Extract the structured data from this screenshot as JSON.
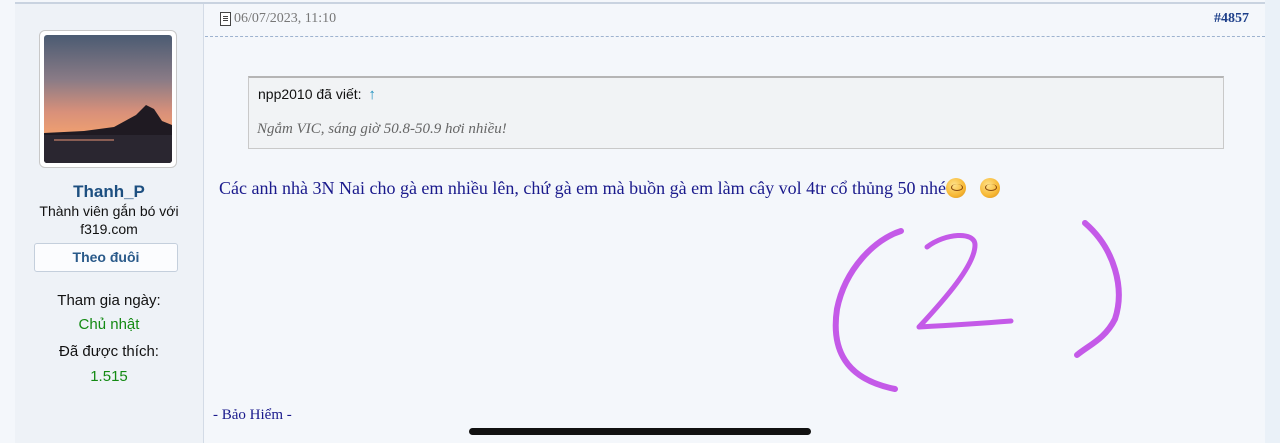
{
  "author": {
    "username": "Thanh_P",
    "rank": "Thành viên gắn bó với f319.com",
    "follow_label": "Theo đuôi",
    "join_label": "Tham gia ngày:",
    "join_value": "Chủ nhật",
    "likes_label": "Đã được thích:",
    "likes_value": "1.515"
  },
  "post": {
    "date": "06/07/2023, 11:10",
    "number": "#4857",
    "quote": {
      "author": "npp2010 đã viết:",
      "arrow": "↑",
      "text": "Ngắm VIC, sáng giờ 50.8-50.9 hơi nhiều!"
    },
    "message": "Các anh nhà 3N Nai cho gà em nhiều lên, chứ gà em mà buồn gà em làm cây vol 4tr cổ thủng 50 nhé",
    "emojis": [
      "smile-emoji",
      "smile-emoji"
    ],
    "signature": "- Bảo Hiểm -"
  },
  "colors": {
    "username": "#1d4f80",
    "message": "#1a1a8c",
    "green_value": "#138a13",
    "post_number": "#1d3f8a",
    "annotation": "#c45ae8"
  },
  "icons": [
    "post-document-icon",
    "quote-jump-arrow-icon"
  ]
}
